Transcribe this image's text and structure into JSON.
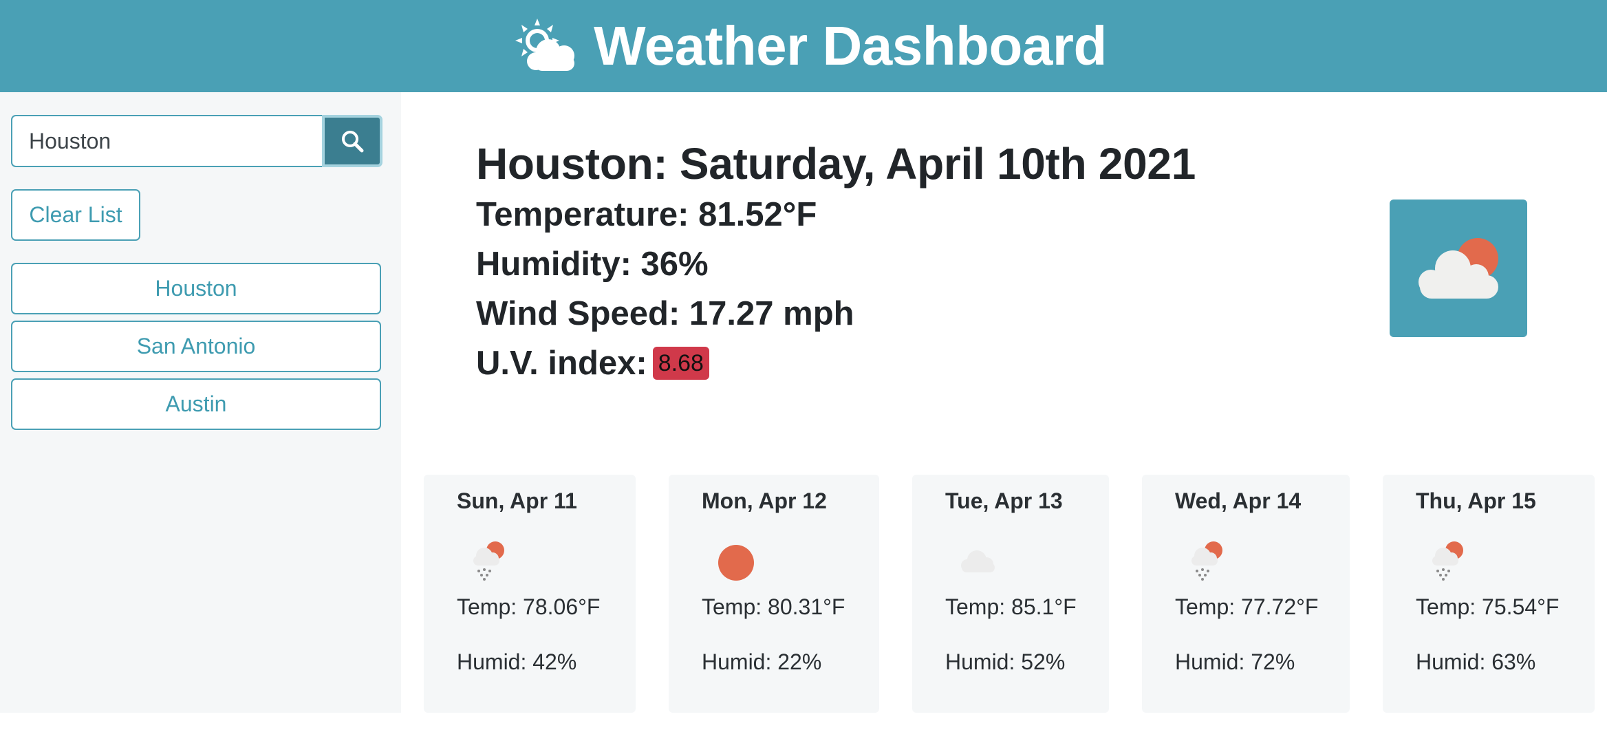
{
  "header": {
    "title": "Weather Dashboard",
    "icon": "sun-cloud-icon"
  },
  "sidebar": {
    "search": {
      "value": "Houston",
      "button_icon": "search-icon"
    },
    "clear_label": "Clear List",
    "history": [
      "Houston",
      "San Antonio",
      "Austin"
    ]
  },
  "current": {
    "title": "Houston: Saturday, April 10th 2021",
    "temperature": "Temperature: 81.52°F",
    "humidity": "Humidity: 36%",
    "wind": "Wind Speed: 17.27 mph",
    "uv_label": "U.V. index:",
    "uv_value": "8.68",
    "uv_color": "#d0394a",
    "icon": "partly-cloudy-icon"
  },
  "forecast": [
    {
      "date": "Sun, Apr 11",
      "temp": "Temp: 78.06°F",
      "humid": "Humid: 42%",
      "icon": "rain-sun-icon"
    },
    {
      "date": "Mon, Apr 12",
      "temp": "Temp: 80.31°F",
      "humid": "Humid: 22%",
      "icon": "sun-icon"
    },
    {
      "date": "Tue, Apr 13",
      "temp": "Temp: 85.1°F",
      "humid": "Humid: 52%",
      "icon": "cloud-icon"
    },
    {
      "date": "Wed, Apr 14",
      "temp": "Temp: 77.72°F",
      "humid": "Humid: 72%",
      "icon": "rain-sun-icon"
    },
    {
      "date": "Thu, Apr 15",
      "temp": "Temp: 75.54°F",
      "humid": "Humid: 63%",
      "icon": "rain-sun-icon"
    }
  ],
  "colors": {
    "accent": "#4aa0b5",
    "accent_dark": "#3b7e90",
    "sun": "#e26a4c",
    "card_bg": "#f5f7f8"
  }
}
